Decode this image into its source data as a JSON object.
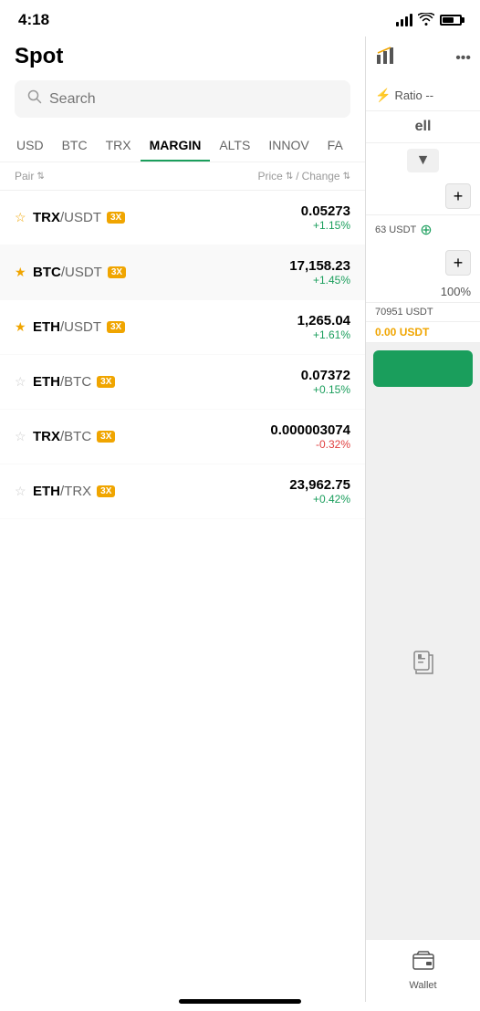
{
  "statusBar": {
    "time": "4:18",
    "battery": 65
  },
  "header": {
    "title": "Spot"
  },
  "search": {
    "placeholder": "Search"
  },
  "tabs": [
    {
      "id": "usd",
      "label": "USD",
      "active": false
    },
    {
      "id": "btc",
      "label": "BTC",
      "active": false
    },
    {
      "id": "trx",
      "label": "TRX",
      "active": false
    },
    {
      "id": "margin",
      "label": "MARGIN",
      "active": true
    },
    {
      "id": "alts",
      "label": "ALTS",
      "active": false
    },
    {
      "id": "innov",
      "label": "INNOV",
      "active": false
    },
    {
      "id": "fa",
      "label": "FA",
      "active": false
    }
  ],
  "tableHeader": {
    "pair": "Pair",
    "price": "Price",
    "change": "Change"
  },
  "pairs": [
    {
      "id": "trx-usdt",
      "base": "TRX",
      "quote": "/USDT",
      "badge": "3X",
      "starred": false,
      "price": "0.05273",
      "change": "+1.15%",
      "changeType": "positive"
    },
    {
      "id": "btc-usdt",
      "base": "BTC",
      "quote": "/USDT",
      "badge": "3X",
      "starred": true,
      "price": "17,158.23",
      "change": "+1.45%",
      "changeType": "positive",
      "selected": true
    },
    {
      "id": "eth-usdt",
      "base": "ETH",
      "quote": "/USDT",
      "badge": "3X",
      "starred": true,
      "price": "1,265.04",
      "change": "+1.61%",
      "changeType": "positive"
    },
    {
      "id": "eth-btc",
      "base": "ETH",
      "quote": "/BTC",
      "badge": "3X",
      "starred": false,
      "price": "0.07372",
      "change": "+0.15%",
      "changeType": "positive"
    },
    {
      "id": "trx-btc",
      "base": "TRX",
      "quote": "/BTC",
      "badge": "3X",
      "starred": false,
      "price": "0.000003074",
      "change": "-0.32%",
      "changeType": "negative"
    },
    {
      "id": "eth-trx",
      "base": "ETH",
      "quote": "/TRX",
      "badge": "3X",
      "starred": false,
      "price": "23,962.75",
      "change": "+0.42%",
      "changeType": "positive"
    }
  ],
  "rightPanel": {
    "ratio": "Ratio --",
    "buySell": "ell",
    "priceDisplay": "63 USDT",
    "percent": "100%",
    "usdtAmount": "70951 USDT",
    "orangeAmount": "0.00 USDT",
    "wallet": "Wallet"
  }
}
